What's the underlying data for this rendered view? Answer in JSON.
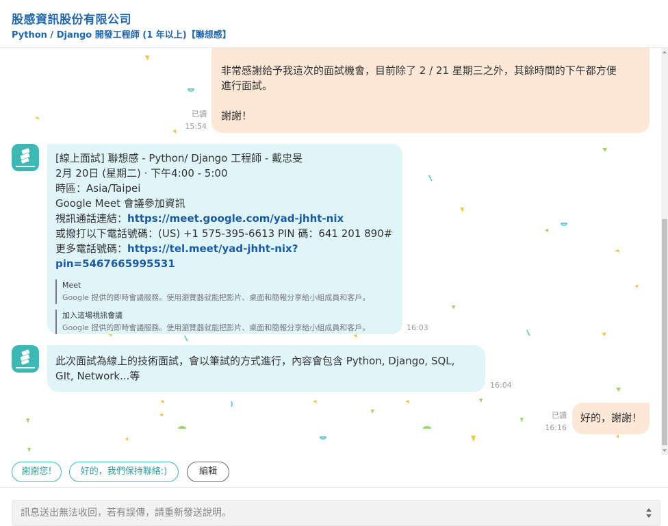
{
  "header": {
    "company": "股感資訊股份有限公司",
    "job_title": "Python / Django 開發工程師 (1 年以上)【聯想感】"
  },
  "messages": [
    {
      "lines": [
        "非常感謝給予我這次的面試機會，目前除了 2 / 21 星期三之外，其餘時間的下午都方便",
        "進行面試。",
        "",
        "謝謝！"
      ],
      "status": "已讀",
      "time": "15:54"
    },
    {
      "l1": "[線上面試] 聯想感 - Python/ Django 工程師 - 戴忠旻",
      "l2": "2月 20日 (星期二) · 下午4:00 - 5:00",
      "l3": "時區：Asia/Taipei",
      "l4": "Google Meet 會議參加資訊",
      "l5_prefix": "視訊通話連結：",
      "l5_link": "https://meet.google.com/yad-jhht-nix",
      "l6": "或撥打以下電話號碼：(US) +1 575-395-6613 PIN 碼：641 201 890#",
      "l7_prefix": "更多電話號碼：",
      "l7_link": "https://tel.meet/yad-jhht-nix?pin=5467665995531",
      "previews": [
        {
          "title": "Meet",
          "desc": "Google 提供的即時會議服務。使用瀏覽器就能把影片、桌面和簡報分享給小組成員和客戶。"
        },
        {
          "title": "加入這場視訊會議",
          "desc": "Google 提供的即時會議服務。使用瀏覽器就能把影片、桌面和簡報分享給小組成員和客戶。"
        }
      ],
      "time": "16:03"
    },
    {
      "lines": [
        "此次面試為線上的技術面試，會以筆試的方式進行，內容會包含 Python, Django, SQL,",
        "GIt, Network...等"
      ],
      "time": "16:04"
    },
    {
      "text": "好的，謝謝！",
      "status": "已讀",
      "time": "16:16"
    }
  ],
  "quick_replies": [
    "謝謝您!",
    "好的，我們保持聯絡:)",
    "編輯"
  ],
  "composer": {
    "placeholder": "訊息送出無法收回，若有誤傳，請重新發送說明。"
  },
  "colors": {
    "brand": "#2167ae",
    "teal": "#3cb8b5",
    "bubble_out": "#fde8d8",
    "bubble_in": "#e0f5f8",
    "link": "#1a5aa6"
  },
  "icons": {
    "avatar": "company-logo-icon",
    "scroll_up": "arrow-up-icon",
    "scroll_down": "arrow-down-icon",
    "spinner": "stepper-icon"
  }
}
